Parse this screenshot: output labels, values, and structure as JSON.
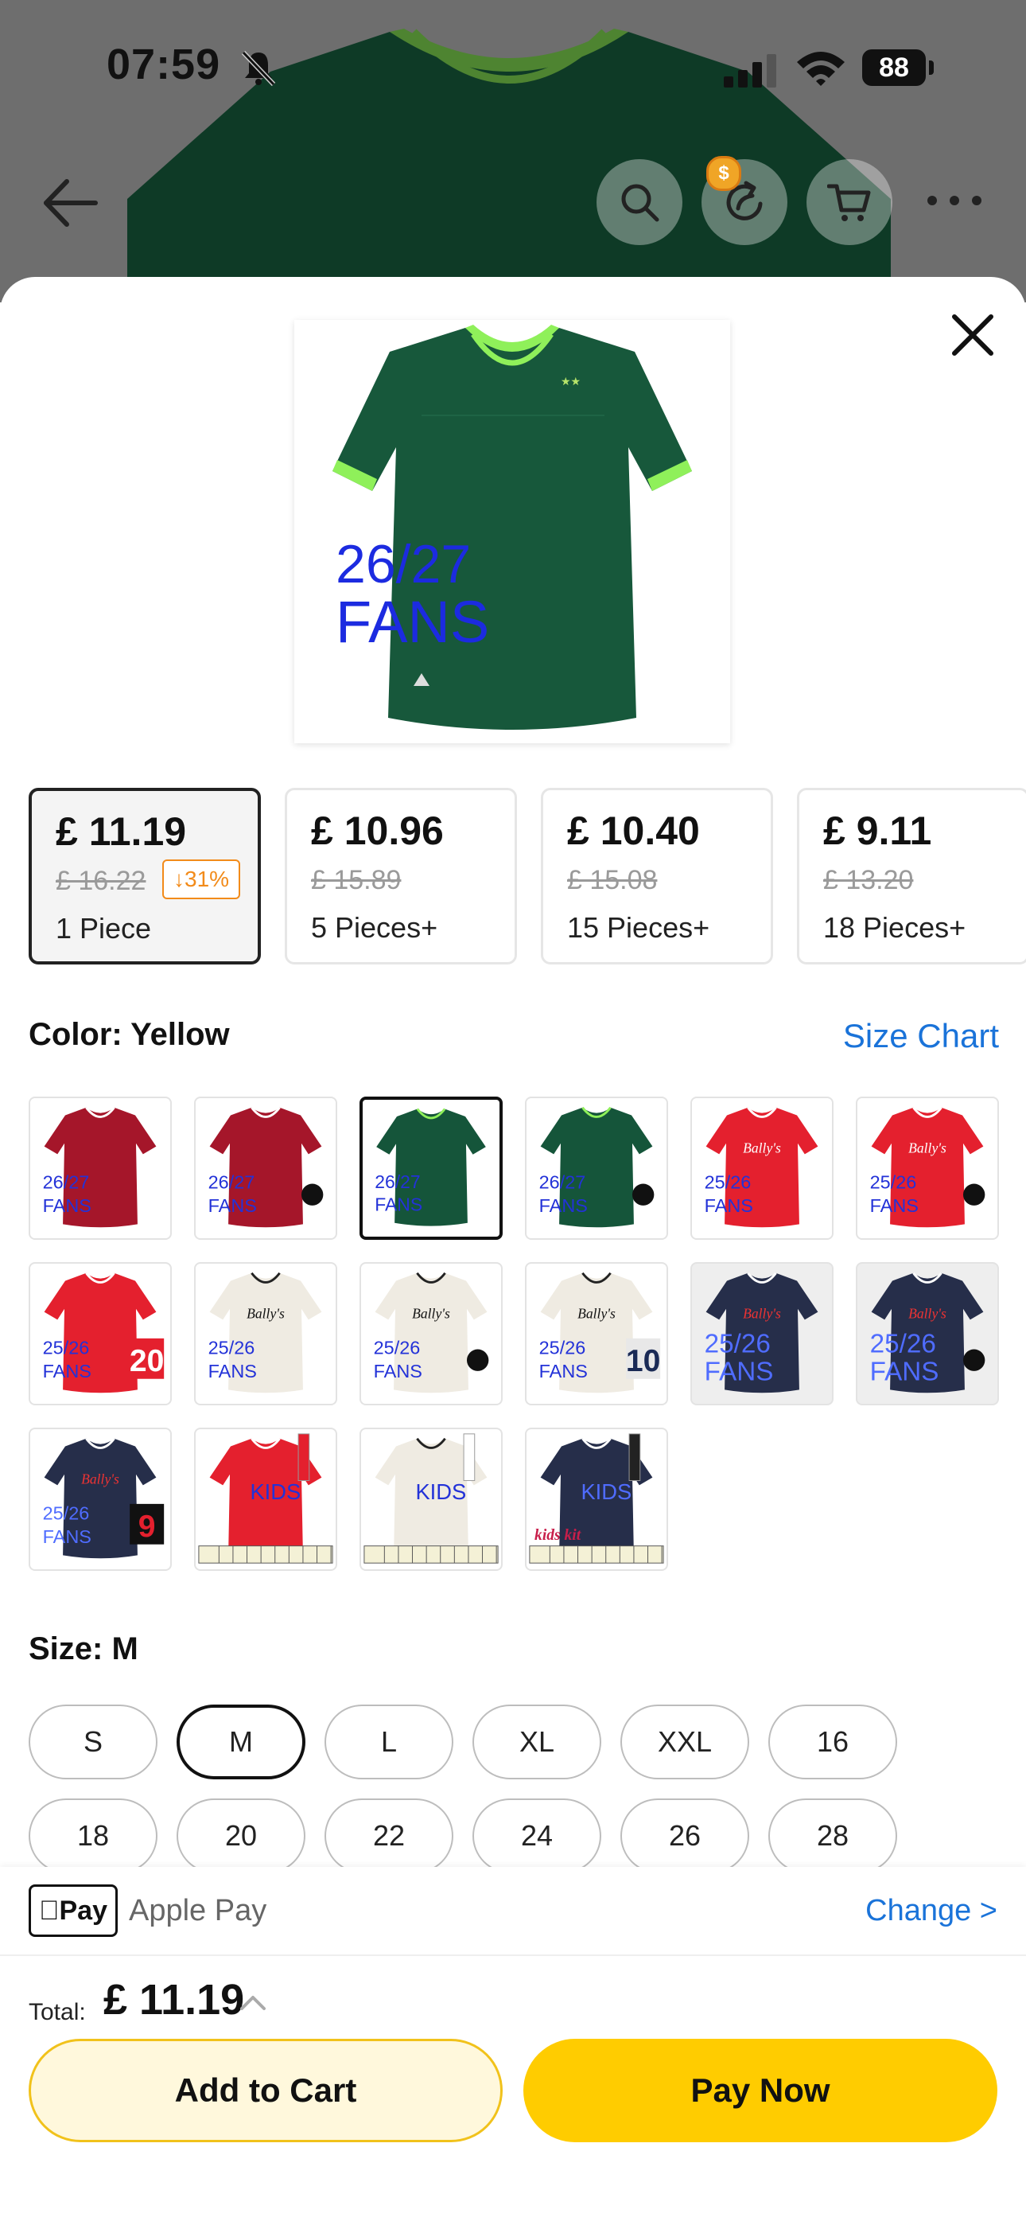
{
  "status": {
    "time": "07:59",
    "battery": "88"
  },
  "sheet": {
    "product_text": {
      "season": "26/27",
      "edition": "FANS"
    },
    "tiers": [
      {
        "price": "£ 11.19",
        "old_price": "£ 16.22",
        "discount": "↓31%",
        "qty": "1 Piece",
        "selected": true
      },
      {
        "price": "£ 10.96",
        "old_price": "£ 15.89",
        "qty": "5 Pieces+"
      },
      {
        "price": "£ 10.40",
        "old_price": "£ 15.08",
        "qty": "15 Pieces+"
      },
      {
        "price": "£ 9.11",
        "old_price": "£ 13.20",
        "qty": "18 Pieces+"
      }
    ],
    "color_label": "Color: Yellow",
    "size_chart": "Size Chart",
    "swatches": [
      {
        "shirt": "#a5162a",
        "label": "26/27\nFANS",
        "badge": ""
      },
      {
        "shirt": "#a5162a",
        "label": "26/27\nFANS",
        "badge": "lion"
      },
      {
        "shirt": "#15553a",
        "label": "26/27\nFANS",
        "badge": "",
        "selected": true
      },
      {
        "shirt": "#15553a",
        "label": "26/27\nFANS",
        "badge": "lion"
      },
      {
        "shirt": "#e4202e",
        "label": "25/26\nFANS",
        "badge": "",
        "sponsor": "Bally's"
      },
      {
        "shirt": "#e4202e",
        "label": "25/26\nFANS",
        "badge": "lion",
        "sponsor": "Bally's"
      },
      {
        "shirt": "#e4202e",
        "label": "25/26\nFANS",
        "badge": "20",
        "sponsor": ""
      },
      {
        "shirt": "#efebe2",
        "label": "25/26\nFANS",
        "badge": "",
        "sponsor": "Bally's"
      },
      {
        "shirt": "#efebe2",
        "label": "25/26\nFANS",
        "badge": "lion",
        "sponsor": "Bally's"
      },
      {
        "shirt": "#efebe2",
        "label": "25/26\nFANS",
        "badge": "10",
        "sponsor": "Bally's"
      },
      {
        "shirt": "#262e4a",
        "label": "25/26\nFANS",
        "badge": "",
        "sponsor": "Bally's",
        "grey": true
      },
      {
        "shirt": "#262e4a",
        "label": "25/26\nFANS",
        "badge": "lion",
        "sponsor": "Bally's",
        "grey": true
      },
      {
        "shirt": "#262e4a",
        "label": "25/26\nFANS",
        "badge": "9",
        "sponsor": "Bally's"
      },
      {
        "shirt": "#e4202e",
        "label": "KIDS",
        "badge": "kit",
        "sponsor": ""
      },
      {
        "shirt": "#efebe2",
        "label": "KIDS",
        "badge": "kit",
        "sponsor": ""
      },
      {
        "shirt": "#262e4a",
        "label": "KIDS",
        "badge": "kit",
        "sponsor": "kids kit"
      }
    ],
    "size_label": "Size: M",
    "sizes": [
      "S",
      "M",
      "L",
      "XL",
      "XXL",
      "16",
      "18",
      "20",
      "22",
      "24",
      "26",
      "28"
    ],
    "selected_size": "M"
  },
  "bottom": {
    "pay_badge": "Pay",
    "pay_method": "Apple Pay",
    "change": "Change >",
    "total_label": "Total:",
    "total_value": "£ 11.19",
    "add_to_cart": "Add to Cart",
    "pay_now": "Pay Now"
  },
  "colors": {
    "accent": "#ffcc00",
    "link": "#1a73d9",
    "discount": "#f28b1a"
  }
}
